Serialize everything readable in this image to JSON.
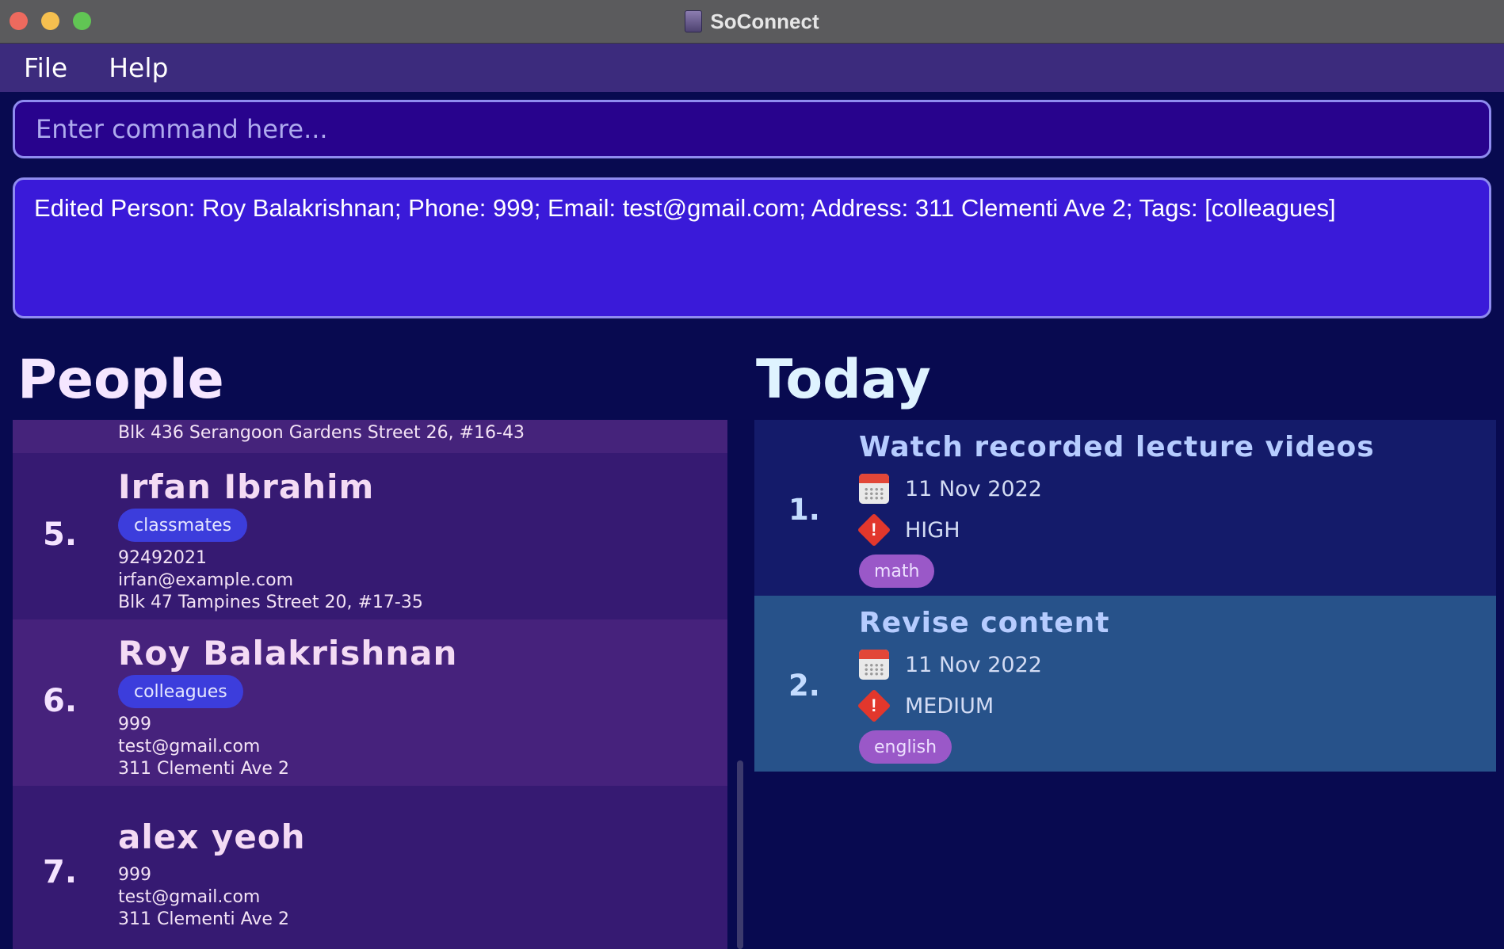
{
  "window": {
    "title": "SoConnect"
  },
  "menu": {
    "items": [
      "File",
      "Help"
    ]
  },
  "command": {
    "placeholder": "Enter command here..."
  },
  "result": {
    "text": "Edited Person: Roy Balakrishnan; Phone: 999; Email: test@gmail.com; Address: 311 Clementi Ave 2; Tags: [colleagues]"
  },
  "people": {
    "heading": "People",
    "partial_address": "Blk 436 Serangoon Gardens Street 26, #16-43",
    "items": [
      {
        "index": "5.",
        "name": "Irfan Ibrahim",
        "tag": "classmates",
        "phone": "92492021",
        "email": "irfan@example.com",
        "address": "Blk 47 Tampines Street 20, #17-35"
      },
      {
        "index": "6.",
        "name": "Roy Balakrishnan",
        "tag": "colleagues",
        "phone": "999",
        "email": "test@gmail.com",
        "address": "311 Clementi Ave 2"
      },
      {
        "index": "7.",
        "name": "alex yeoh",
        "phone": "999",
        "email": "test@gmail.com",
        "address": "311 Clementi Ave 2"
      }
    ]
  },
  "today": {
    "heading": "Today",
    "tasks": [
      {
        "index": "1.",
        "title": "Watch recorded lecture videos",
        "date": "11 Nov 2022",
        "priority": "HIGH",
        "tag": "math"
      },
      {
        "index": "2.",
        "title": "Revise content",
        "date": "11 Nov 2022",
        "priority": "MEDIUM",
        "tag": "english"
      }
    ]
  },
  "icons": {
    "date": "calendar-icon",
    "priority": "priority-warning-icon"
  }
}
